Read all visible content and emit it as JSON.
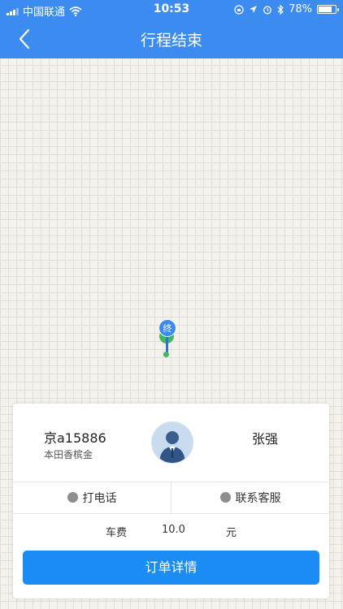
{
  "status_bar": {
    "carrier": "中国联通",
    "time": "10:53",
    "battery": "78%",
    "battery_level": 0.78
  },
  "nav": {
    "title": "行程结束"
  },
  "map": {
    "end_marker_label": "终"
  },
  "card": {
    "plate": "京a15886",
    "car_model": "本田香槟金",
    "driver_name": "张强",
    "call_label": "打电话",
    "service_label": "联系客服",
    "fare_label": "车费",
    "fare_value": "10.0",
    "fare_unit": "元",
    "order_detail_label": "订单详情"
  },
  "colors": {
    "primary": "#3b8bf0",
    "button": "#1b8cf3",
    "map_bg": "#f4f2ec"
  }
}
